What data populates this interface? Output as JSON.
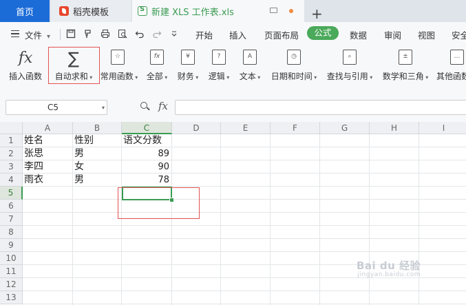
{
  "tabs": {
    "home": "首页",
    "docer": "稻壳模板",
    "doc": "新建 XLS 工作表.xls",
    "add": "+"
  },
  "menu": {
    "file": "文件",
    "file_arrow": "▾",
    "items": [
      "开始",
      "插入",
      "页面布局",
      "公式",
      "数据",
      "审阅",
      "视图",
      "安全"
    ],
    "active": "公式"
  },
  "ribbon": {
    "insert_function": {
      "label": "插入函数",
      "icon": "fx-icon"
    },
    "autosum": {
      "label": "自动求和",
      "icon": "sigma-icon"
    },
    "common": {
      "label": "常用函数",
      "icon": "star-function-icon"
    },
    "all": {
      "label": "全部",
      "icon": "fx-book-icon"
    },
    "finance": {
      "label": "财务",
      "icon": "yen-book-icon"
    },
    "logic": {
      "label": "逻辑",
      "icon": "question-book-icon"
    },
    "text": {
      "label": "文本",
      "icon": "a-book-icon"
    },
    "datetime": {
      "label": "日期和时间",
      "icon": "clock-book-icon"
    },
    "lookup": {
      "label": "查找与引用",
      "icon": "search-book-icon"
    },
    "math": {
      "label": "数学和三角",
      "icon": "plusminus-book-icon"
    },
    "other": {
      "label": "其他函数",
      "icon": "more-book-icon"
    }
  },
  "formula_bar": {
    "name_box": "C5",
    "fx": "fx",
    "formula": ""
  },
  "sheet": {
    "columns": [
      "A",
      "B",
      "C",
      "D",
      "E",
      "F",
      "G",
      "H",
      "I"
    ],
    "rows": [
      "1",
      "2",
      "3",
      "4",
      "5",
      "6",
      "7",
      "8",
      "9",
      "10",
      "11",
      "12",
      "13"
    ],
    "selected_cell": "C5",
    "cells": {
      "A1": "姓名",
      "B1": "性别",
      "C1": "语文分数",
      "A2": "张思",
      "B2": "男",
      "C2": "89",
      "A3": "李四",
      "B3": "女",
      "C3": "90",
      "A4": "雨衣",
      "B4": "男",
      "C4": "78"
    }
  },
  "watermark": {
    "main": "Bai du 经验",
    "sub": "jingyan.baidu.com"
  },
  "colors": {
    "accent_green": "#3a9b52",
    "highlight_red": "#e05252",
    "home_tab_blue": "#1c6cd8"
  }
}
